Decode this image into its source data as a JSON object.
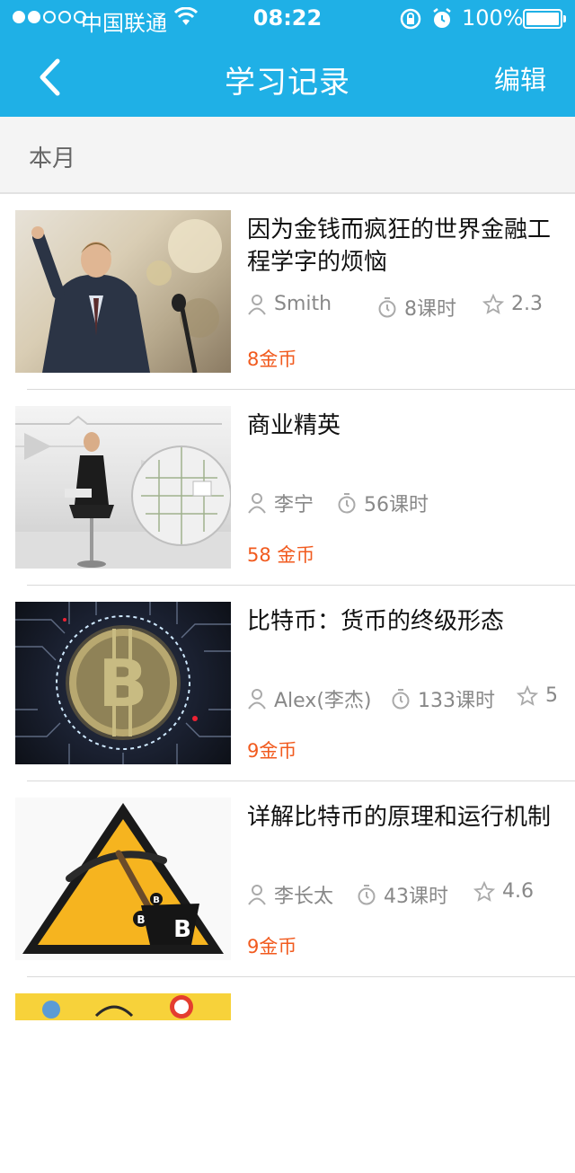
{
  "status": {
    "carrier": "中国联通",
    "time": "08:22",
    "battery": "100%"
  },
  "nav": {
    "title": "学习记录",
    "edit": "编辑"
  },
  "section": {
    "title": "本月"
  },
  "courses": [
    {
      "title": "因为金钱而疯狂的世界金融工程学字的烦恼",
      "author": "Smith",
      "hours": "8课时",
      "rating": "2.3",
      "price": "8金币"
    },
    {
      "title": "商业精英",
      "author": "李宁",
      "hours": "56课时",
      "rating": "",
      "price": "58 金币"
    },
    {
      "title": "比特币：货币的终级形态",
      "author": "Alex(李杰)",
      "hours": "133课时",
      "rating": "5",
      "price": "9金币"
    },
    {
      "title": "详解比特币的原理和运行机制",
      "author": "李长太",
      "hours": "43课时",
      "rating": "4.6",
      "price": "9金币"
    }
  ]
}
